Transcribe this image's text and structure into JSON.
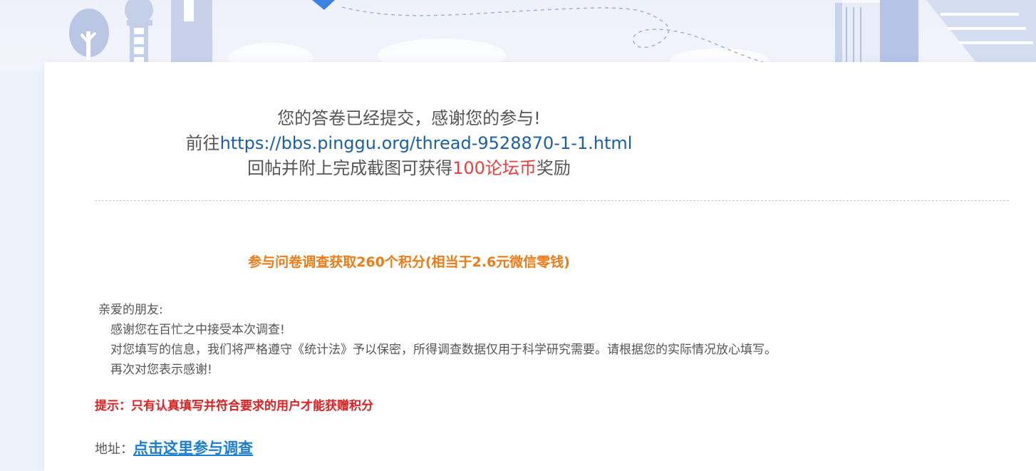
{
  "banner": {
    "illustration": "city-skyline-decoration"
  },
  "submit_message": {
    "line1": "您的答卷已经提交，感谢您的参与!",
    "line2_prefix": "前往",
    "line2_link": "https://bbs.pinggu.org/thread-9528870-1-1.html",
    "line3_prefix": "回帖并附上完成截图可获得",
    "line3_reward": "100论坛币",
    "line3_suffix": "奖励"
  },
  "survey": {
    "title": "参与问卷调查获取260个积分(相当于2.6元微信零钱)",
    "greeting": "亲爱的朋友:",
    "lines": [
      "感谢您在百忙之中接受本次调查!",
      "对您填写的信息，我们将严格遵守《统计法》予以保密，所得调查数据仅用于科学研究需要。请根据您的实际情况放心填写。",
      "再次对您表示感谢!"
    ],
    "notice": "提示：只有认真填写并符合要求的用户才能获赠积分",
    "address_label": "地址：",
    "address_link": "点击这里参与调查"
  },
  "colors": {
    "accent_orange": "#f07a16",
    "link_blue": "#1a5fa8",
    "reward_red": "#ef3c3c",
    "notice_red": "#e02020"
  }
}
